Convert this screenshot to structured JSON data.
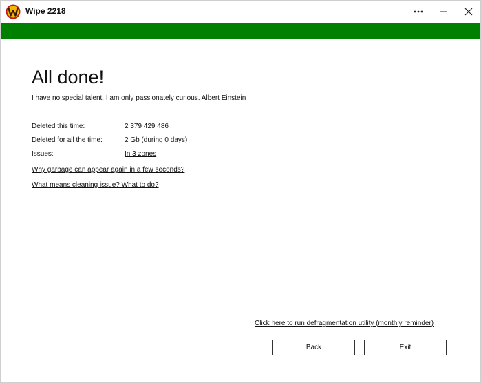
{
  "window": {
    "title": "Wipe 2218",
    "accent_color": "#008000",
    "logo_icon": "wipe-w-logo-icon",
    "controls": {
      "more_icon": "more-horizontal-icon",
      "minimize_icon": "minimize-icon",
      "close_icon": "close-icon"
    }
  },
  "main": {
    "heading": "All done!",
    "quote": "I have no special talent. I am only passionately curious. Albert Einstein",
    "stats": [
      {
        "label": "Deleted this time:",
        "value": "2 379 429 486"
      },
      {
        "label": "Deleted for all the time:",
        "value": "2 Gb (during 0 days)"
      },
      {
        "label": "Issues:",
        "value": "In 3 zones"
      }
    ],
    "help_links": [
      "Why garbage can appear again in a few seconds?",
      "What means cleaning issue? What to do?"
    ]
  },
  "footer": {
    "defrag_link": "Click here to run defragmentation utility (monthly reminder)",
    "back_label": "Back",
    "exit_label": "Exit"
  }
}
